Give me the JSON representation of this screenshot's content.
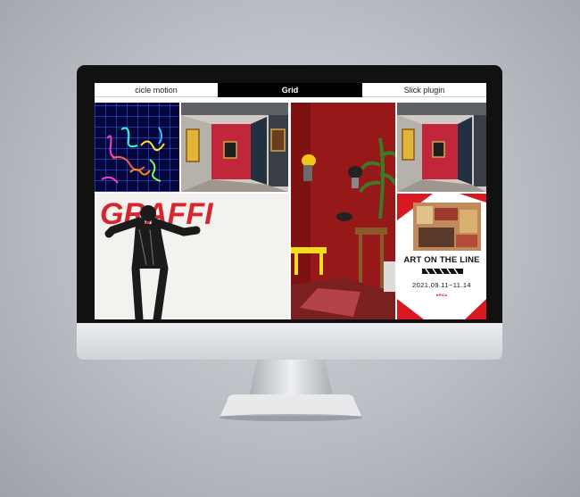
{
  "tabs": [
    {
      "label": "cicle motion",
      "active": false
    },
    {
      "label": "Grid",
      "active": true
    },
    {
      "label": "Slick plugin",
      "active": false
    }
  ],
  "poster": {
    "title": "ART ON THE LINE",
    "dates": "2021.09.11~11.14",
    "logo": "KPICA"
  },
  "graffiti_text": "GRAFFI",
  "colors": {
    "background": "#b9bdc3",
    "bezel": "#111111",
    "active_tab": "#000000",
    "red_wall": "#9a1616",
    "poster_red": "#d71921"
  },
  "icons": [
    "monitor-stand"
  ]
}
